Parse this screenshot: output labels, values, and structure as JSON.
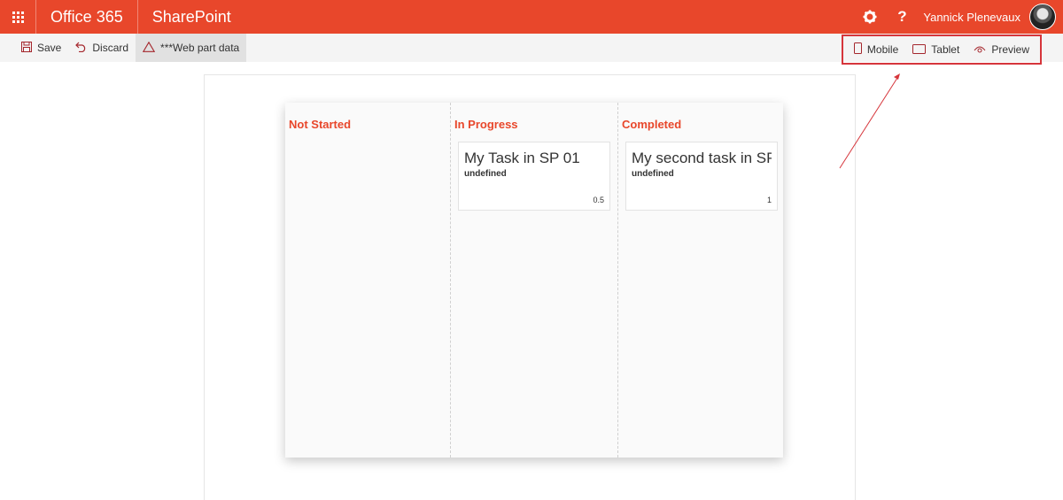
{
  "colors": {
    "brand": "#e8472b",
    "accent": "#a4262c",
    "annotation": "#d6353b"
  },
  "suitebar": {
    "waffle_icon": "app-launcher-icon",
    "brand": "Office 365",
    "app": "SharePoint",
    "settings_icon": "gear-icon",
    "help_label": "?",
    "user_name": "Yannick Plenevaux"
  },
  "commandbar": {
    "save": "Save",
    "discard": "Discard",
    "webpart": "***Web part data",
    "mobile": "Mobile",
    "tablet": "Tablet",
    "preview": "Preview"
  },
  "board": {
    "columns": [
      {
        "title": "Not Started",
        "cards": []
      },
      {
        "title": "In Progress",
        "cards": [
          {
            "title": "My Task in SP 01",
            "sub": "undefined",
            "value": "0.5"
          }
        ]
      },
      {
        "title": "Completed",
        "cards": [
          {
            "title": "My second task in SP",
            "sub": "undefined",
            "value": "1"
          }
        ]
      }
    ]
  }
}
